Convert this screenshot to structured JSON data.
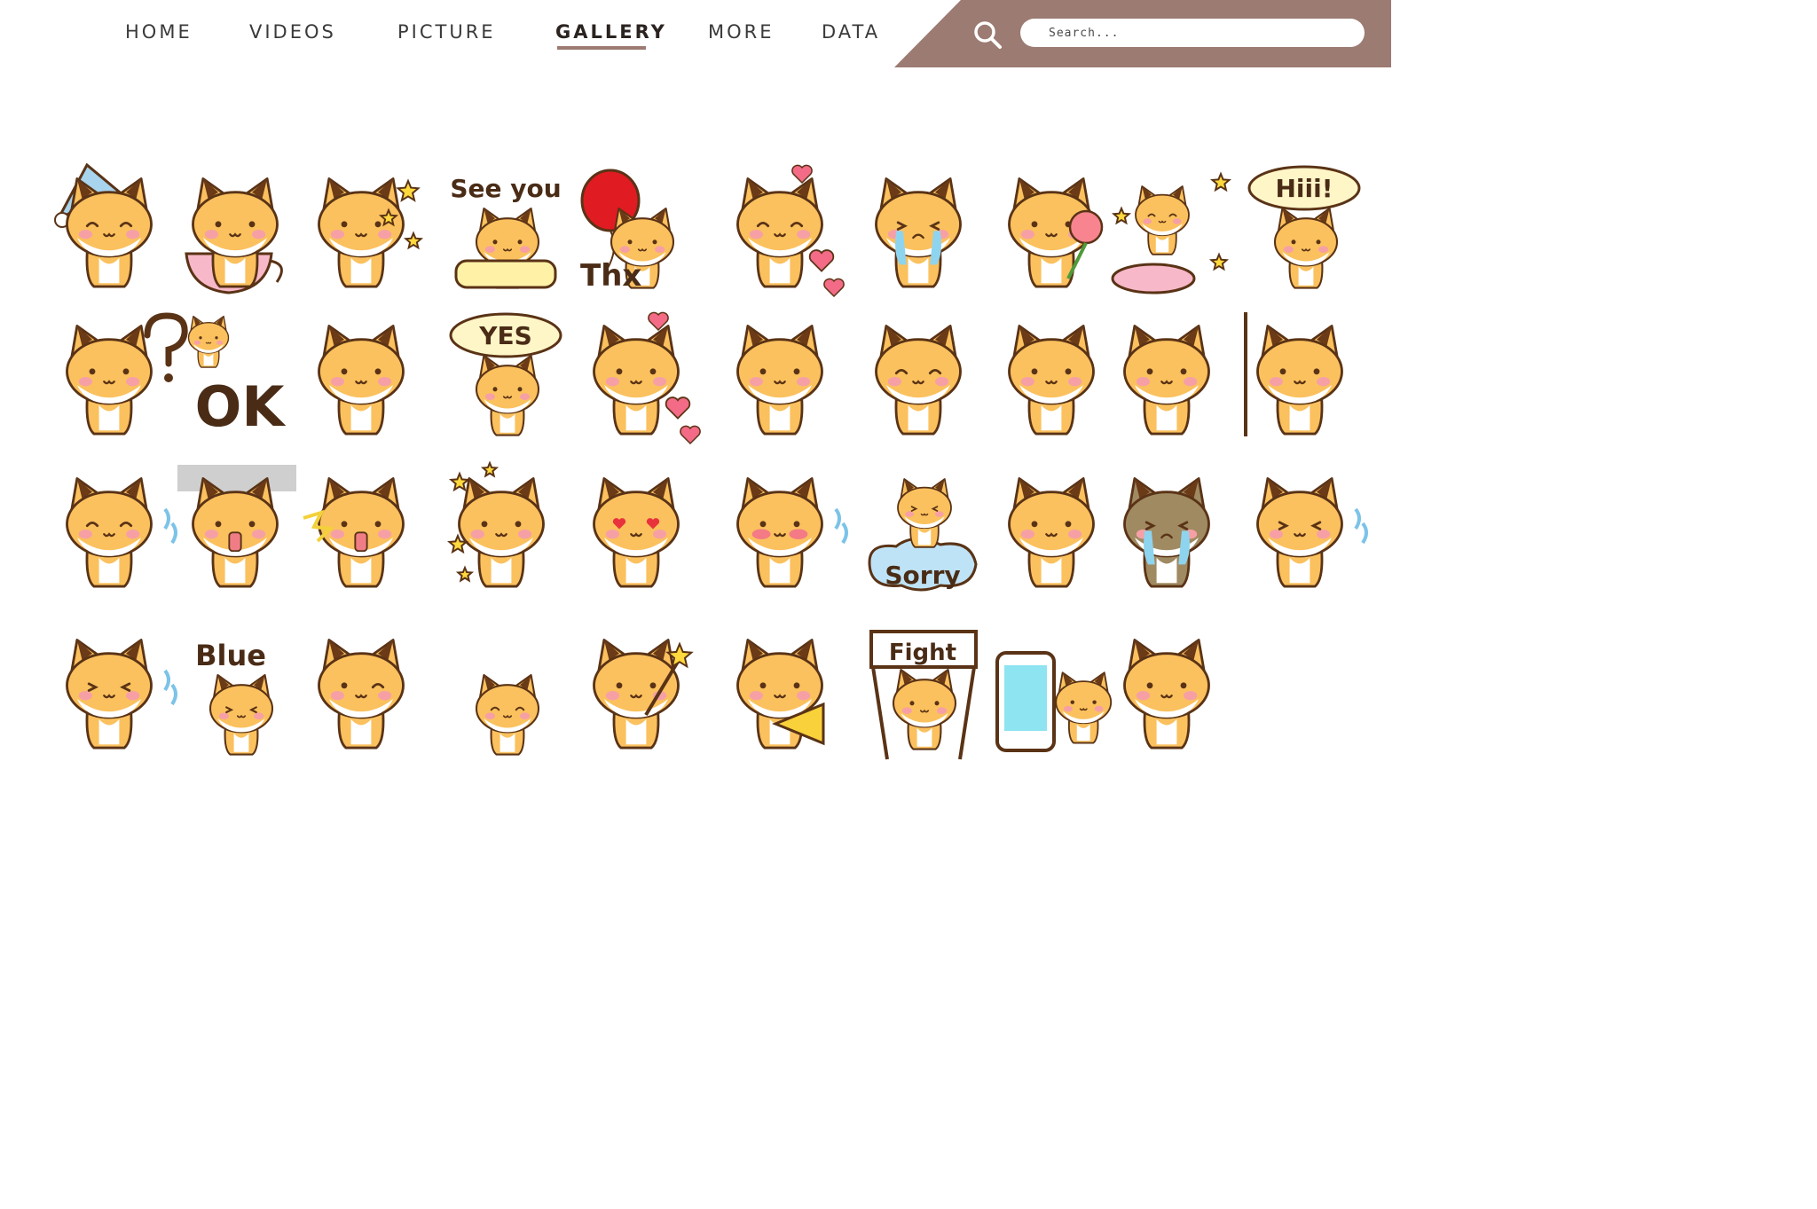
{
  "nav": {
    "items": [
      {
        "label": "HOME",
        "active": false
      },
      {
        "label": "VIDEOS",
        "active": false
      },
      {
        "label": "PICTURE",
        "active": false
      },
      {
        "label": "GALLERY",
        "active": true
      },
      {
        "label": "MORE",
        "active": false
      },
      {
        "label": "DATA",
        "active": false
      }
    ]
  },
  "search": {
    "placeholder": "Search..."
  },
  "colors": {
    "accent_band": "#9c7b72",
    "fox_body": "#fbc15e",
    "fox_outline": "#5a3316",
    "fox_ear_tip": "#6b3a16",
    "blush": "#f6a0a6",
    "tear": "#8fd4ee",
    "star": "#ffd93d",
    "pink": "#f7b9c9",
    "balloon": "#e01b22"
  },
  "stickers": [
    {
      "id": 1,
      "caption": "",
      "prop": "nightcap",
      "expression": "sleepy"
    },
    {
      "id": 2,
      "caption": "",
      "prop": "cup",
      "expression": "smile"
    },
    {
      "id": 3,
      "caption": "",
      "prop": "stars",
      "expression": "smile"
    },
    {
      "id": 4,
      "caption": "See you",
      "prop": "candy",
      "expression": "smile"
    },
    {
      "id": 5,
      "caption": "Thx",
      "prop": "balloon",
      "expression": "smile"
    },
    {
      "id": 6,
      "caption": "",
      "prop": "hearts",
      "expression": "happy"
    },
    {
      "id": 7,
      "caption": "",
      "prop": "tears",
      "expression": "crying"
    },
    {
      "id": 8,
      "caption": "",
      "prop": "rose",
      "expression": "smile"
    },
    {
      "id": 9,
      "caption": "",
      "prop": "music",
      "expression": "happy"
    },
    {
      "id": 10,
      "caption": "Hiii!",
      "prop": "bubble",
      "expression": "smile"
    },
    {
      "id": 11,
      "caption": "?",
      "prop": "question",
      "expression": "neutral"
    },
    {
      "id": 12,
      "caption": "OK",
      "prop": "ok-letters",
      "expression": "smile"
    },
    {
      "id": 13,
      "caption": "",
      "prop": "wave",
      "expression": "smile"
    },
    {
      "id": 14,
      "caption": "YES",
      "prop": "bubble",
      "expression": "smile"
    },
    {
      "id": 15,
      "caption": "",
      "prop": "hearts",
      "expression": "smile"
    },
    {
      "id": 16,
      "caption": "",
      "prop": "thumbs",
      "expression": "smile"
    },
    {
      "id": 17,
      "caption": "",
      "prop": "peace",
      "expression": "happy"
    },
    {
      "id": 18,
      "caption": "",
      "prop": "none",
      "expression": "smile"
    },
    {
      "id": 19,
      "caption": "",
      "prop": "none",
      "expression": "smile"
    },
    {
      "id": 20,
      "caption": "",
      "prop": "wall",
      "expression": "smile"
    },
    {
      "id": 21,
      "caption": "",
      "prop": "sweat",
      "expression": "happy"
    },
    {
      "id": 22,
      "caption": "",
      "prop": "shock",
      "expression": "shock"
    },
    {
      "id": 23,
      "caption": "",
      "prop": "shout",
      "expression": "shock"
    },
    {
      "id": 24,
      "caption": "",
      "prop": "sparkle",
      "expression": "smile"
    },
    {
      "id": 25,
      "caption": "",
      "prop": "none",
      "expression": "heart-eyes"
    },
    {
      "id": 26,
      "caption": "",
      "prop": "sweat",
      "expression": "blush"
    },
    {
      "id": 27,
      "caption": "Sorry",
      "prop": "cloud",
      "expression": "sad"
    },
    {
      "id": 28,
      "caption": "",
      "prop": "none",
      "expression": "worried"
    },
    {
      "id": 29,
      "caption": "",
      "prop": "gloom",
      "expression": "crying"
    },
    {
      "id": 30,
      "caption": "",
      "prop": "sweat",
      "expression": "sad"
    },
    {
      "id": 31,
      "caption": "",
      "prop": "sweat",
      "expression": "sad"
    },
    {
      "id": 32,
      "caption": "Blue",
      "prop": "lying",
      "expression": "sad"
    },
    {
      "id": 33,
      "caption": "",
      "prop": "point",
      "expression": "wink"
    },
    {
      "id": 34,
      "caption": "",
      "prop": "lying",
      "expression": "happy"
    },
    {
      "id": 35,
      "caption": "",
      "prop": "wand",
      "expression": "smile"
    },
    {
      "id": 36,
      "caption": "",
      "prop": "megaphone",
      "expression": "smile"
    },
    {
      "id": 37,
      "caption": "Fight",
      "prop": "banner",
      "expression": "smile"
    },
    {
      "id": 38,
      "caption": "",
      "prop": "phone",
      "expression": "smile"
    },
    {
      "id": 39,
      "caption": "",
      "prop": "none",
      "expression": "smile"
    }
  ]
}
